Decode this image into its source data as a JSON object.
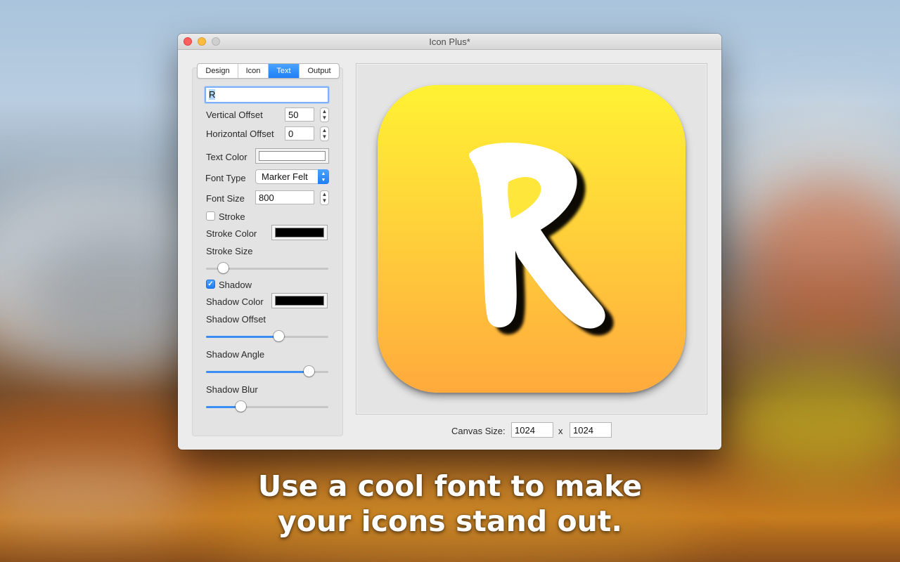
{
  "window": {
    "title": "Icon Plus*"
  },
  "tabs": [
    {
      "label": "Design",
      "active": false
    },
    {
      "label": "Icon",
      "active": false
    },
    {
      "label": "Text",
      "active": true
    },
    {
      "label": "Output",
      "active": false
    }
  ],
  "text_panel": {
    "text_value": "R",
    "vertical_offset_label": "Vertical Offset",
    "vertical_offset_value": "50",
    "horizontal_offset_label": "Horizontal Offset",
    "horizontal_offset_value": "0",
    "text_color_label": "Text Color",
    "text_color": "#ffffff",
    "font_type_label": "Font Type",
    "font_type_value": "Marker Felt",
    "font_size_label": "Font Size",
    "font_size_value": "800",
    "stroke_label": "Stroke",
    "stroke_checked": false,
    "stroke_color_label": "Stroke Color",
    "stroke_color": "#000000",
    "stroke_size_label": "Stroke Size",
    "stroke_size_level": 0.14,
    "shadow_label": "Shadow",
    "shadow_checked": true,
    "shadow_color_label": "Shadow Color",
    "shadow_color": "#000000",
    "shadow_offset_label": "Shadow Offset",
    "shadow_offset_level": 0.59,
    "shadow_angle_label": "Shadow Angle",
    "shadow_angle_level": 0.84,
    "shadow_blur_label": "Shadow Blur",
    "shadow_blur_level": 0.28
  },
  "preview": {
    "icon_letter": "R",
    "gradient_top": "#fff233",
    "gradient_bottom": "#ffaa3d",
    "canvas_size_label": "Canvas Size:",
    "canvas_width": "1024",
    "canvas_height": "1024",
    "separator": "x"
  },
  "tagline": {
    "line1": "Use a cool font to make",
    "line2": "your icons stand out."
  },
  "icons": {
    "close": "close-dot",
    "minimize": "minimize-dot",
    "zoom": "zoom-dot",
    "checkmark": "checkmark-icon"
  }
}
